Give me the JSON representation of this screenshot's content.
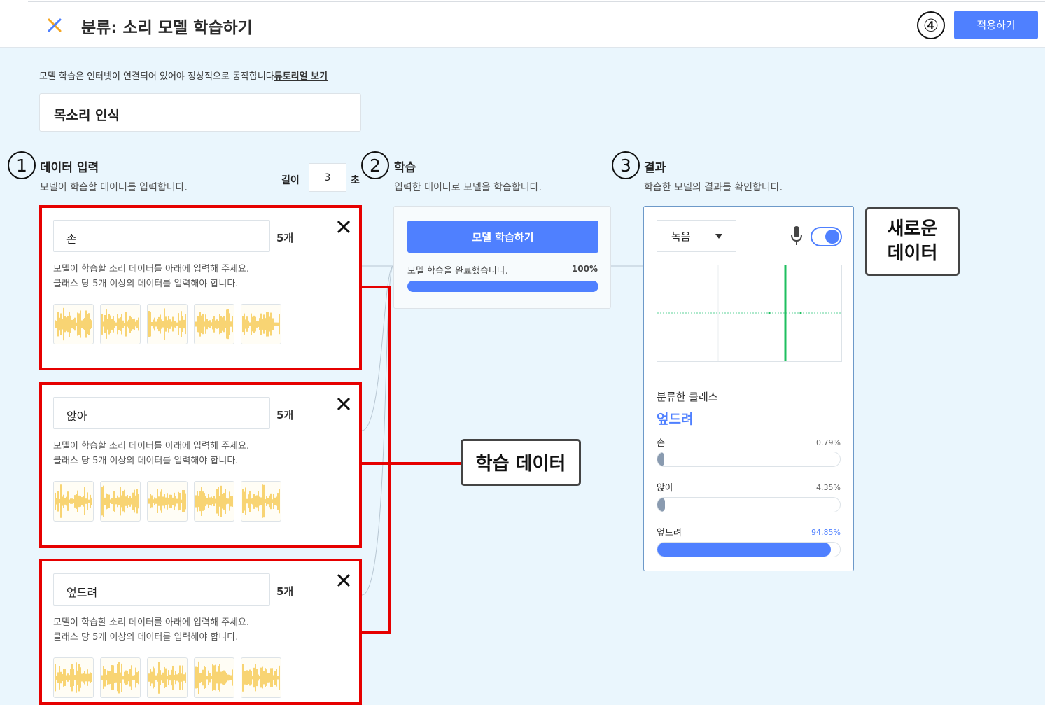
{
  "header": {
    "title": "분류: 소리 모델 학습하기",
    "apply_label": "적용하기",
    "step4": "④"
  },
  "notice": {
    "text": "모델 학습은 인터넷이 연결되어 있어야 정상적으로 동작합니다",
    "tutorial_link": "튜토리얼 보기"
  },
  "project_name": "목소리 인식",
  "input_section": {
    "step": "1",
    "title": "데이터 입력",
    "desc": "모델이 학습할 데이터를 입력합니다.",
    "length_label": "길이",
    "length_value": "3",
    "length_unit": "초"
  },
  "classes": [
    {
      "name": "손",
      "count": "5개",
      "hint1": "모델이 학습할 소리 데이터를 아래에 입력해 주세요.",
      "hint2": "클래스 당 5개 이상의 데이터를 입력해야 합니다."
    },
    {
      "name": "앉아",
      "count": "5개",
      "hint1": "모델이 학습할 소리 데이터를 아래에 입력해 주세요.",
      "hint2": "클래스 당 5개 이상의 데이터를 입력해야 합니다."
    },
    {
      "name": "엎드려",
      "count": "5개",
      "hint1": "모델이 학습할 소리 데이터를 아래에 입력해 주세요.",
      "hint2": "클래스 당 5개 이상의 데이터를 입력해야 합니다."
    }
  ],
  "train_section": {
    "step": "2",
    "title": "학습",
    "desc": "입력한 데이터로 모델을 학습합니다.",
    "button_label": "모델 학습하기",
    "status": "모델 학습을 완료했습니다.",
    "progress_text": "100%",
    "progress": 1.0
  },
  "result_section": {
    "step": "3",
    "title": "결과",
    "desc": "학습한 모델의 결과를 확인합니다.",
    "source_select": "녹음",
    "classified_label": "분류한 클래스",
    "classified_value": "엎드려",
    "probabilities": [
      {
        "name": "손",
        "value_text": "0.79%",
        "value": 0.0079
      },
      {
        "name": "앉아",
        "value_text": "4.35%",
        "value": 0.0435
      },
      {
        "name": "엎드려",
        "value_text": "94.85%",
        "value": 0.9485
      }
    ]
  },
  "callouts": {
    "new_data": "새로운\n데이터",
    "train_data": "학습 데이터"
  },
  "colors": {
    "accent": "#4f80ff",
    "highlight_border": "#e60000",
    "waveform": "#f2b91c",
    "background": "#eaf6fd"
  }
}
